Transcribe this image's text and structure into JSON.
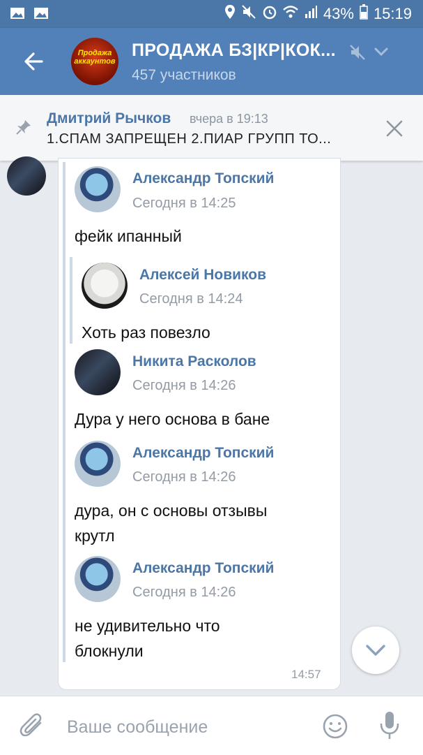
{
  "statusbar": {
    "battery": "43%",
    "time": "15:19"
  },
  "header": {
    "title": "ПРОДАЖА БЗ|КР|КОК...",
    "subtitle": "457 участников",
    "avatar_text": "Продажа аккаунтов"
  },
  "pinned": {
    "author": "Дмитрий Рычков",
    "time": "вчера в 19:13",
    "text": "1.СПАМ ЗАПРЕЩЕН  2.ПИАР ГРУПП ТО..."
  },
  "messages": [
    {
      "author": "Александр Топский",
      "time": "Сегодня в 14:25",
      "text": "фейк ипанный"
    },
    {
      "author": "Алексей Новиков",
      "time": "Сегодня в 14:24",
      "text": "Хоть раз повезло"
    },
    {
      "author": "Никита Расколов",
      "time": "Сегодня в 14:26",
      "text": "Дура у него основа в бане"
    },
    {
      "author": "Александр Топский",
      "time": "Сегодня в 14:26",
      "text_line1": "дура, он с основы отзывы",
      "text_line2": "крутл"
    },
    {
      "author": "Александр Топский",
      "time": "Сегодня в 14:26",
      "text_line1": "не удивительно что",
      "text_line2": "блокнули"
    }
  ],
  "bubble_time": "14:57",
  "composer": {
    "placeholder": "Ваше сообщение"
  },
  "colors": {
    "header": "#5181b8",
    "statusbar": "#4a76a8",
    "link": "#4a76a8",
    "background": "#e7ebf0"
  }
}
